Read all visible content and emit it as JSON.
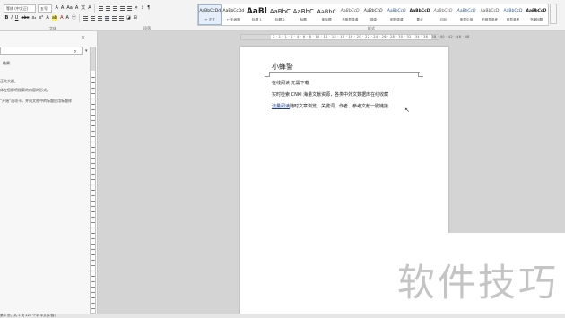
{
  "ribbon": {
    "font_name": "等线 (中文正)",
    "font_size": "五号",
    "group_font": "字体",
    "group_paragraph": "段落",
    "group_styles": "样式",
    "styles": [
      {
        "sample": "AaBbCcDd",
        "name": "↵ 正文"
      },
      {
        "sample": "AaBbCcDd",
        "name": "↵ 无间隔"
      },
      {
        "sample": "AaBl",
        "name": "标题 1"
      },
      {
        "sample": "AaBbC",
        "name": "标题 2"
      },
      {
        "sample": "AaBbC",
        "name": "标题"
      },
      {
        "sample": "AaBbC",
        "name": "副标题"
      },
      {
        "sample": "AaBbCcD",
        "name": "不明显强调"
      },
      {
        "sample": "AaBbCcD",
        "name": "强调"
      },
      {
        "sample": "AaBbCcD",
        "name": "明显强调"
      },
      {
        "sample": "AaBbCcD",
        "name": "要点"
      },
      {
        "sample": "AaBbCcD",
        "name": "引用"
      },
      {
        "sample": "AaBbCcD",
        "name": "明显引用"
      },
      {
        "sample": "AaBbCcD",
        "name": "不明显参考"
      },
      {
        "sample": "AaBbCcD",
        "name": "明显参考"
      },
      {
        "sample": "AaBbCcD",
        "name": "书籍标题"
      }
    ]
  },
  "nav": {
    "tab": "结果",
    "line1": "正文大纲。",
    "line2": "体在您即将搜索的内容的形式。",
    "line3": "“开始”选项卡，并向文档中的标题应用标题样"
  },
  "ruler": {
    "numbers": "2 · 1 · 1 · 2 · 4 · 6 · 8 · 10 · 12 · 14 · 16 · 18 · 20 · 22 · 24 · 26 · 28 · 30 · 32 · 34 · 36 · 38 · 40 · 42 · 46 · 48"
  },
  "document": {
    "title": "小蜂警",
    "para1": "在线阅读  无需下载",
    "para2": "实时检索 CNKI 海量文献资源，各类中外文数据库在线收藏",
    "para3_link": "流量阅读",
    "para3_rest": "随时文章浏览、关键词、作者、参考文献一键链接"
  },
  "watermark": "软件技巧",
  "status": {
    "text": "第 1 页，共 1 页    122 个字    中文(中国)"
  }
}
